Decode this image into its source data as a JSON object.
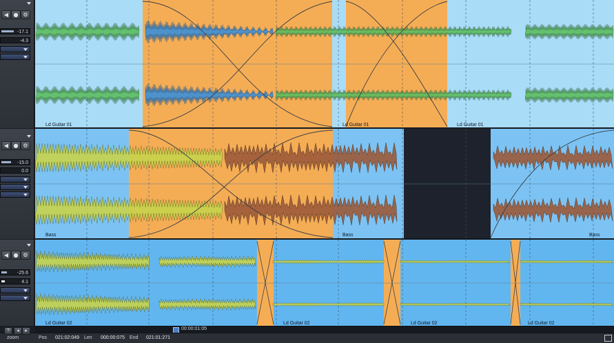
{
  "tracks": [
    {
      "id": "track1",
      "header": {
        "value1": "-17.1",
        "value2": "-4.3"
      },
      "clips": [
        {
          "label": "Ld Guitar 01"
        },
        {
          "label": "Ld Guitar 01"
        },
        {
          "label": "Ld Guitar 01"
        }
      ]
    },
    {
      "id": "track2",
      "header": {
        "value1": "-15.0",
        "value2": "0.0"
      },
      "clips": [
        {
          "label": "Bass"
        },
        {
          "label": "Bass"
        },
        {
          "label": "Bass"
        }
      ]
    },
    {
      "id": "track3",
      "header": {
        "value1": "-25.6",
        "value2": "4.1"
      },
      "clips": [
        {
          "label": "Ld Guitar 02"
        },
        {
          "label": "Ld Guitar 02"
        },
        {
          "label": "Ld Guitar 02"
        },
        {
          "label": "Ld Guitar 02"
        }
      ]
    }
  ],
  "ruler": {
    "position": "00:00:01:05"
  },
  "statusbar": {
    "zoom_label": "zoom",
    "pos_label": "Pos",
    "pos_value": "021:02:049",
    "len_label": "Len",
    "len_value": "000:00:075",
    "end_label": "End",
    "end_value": "021:01:271",
    "help_icon": "?"
  },
  "colors": {
    "lane_light": "#a9dcf7",
    "lane_mid": "#7cc3f4",
    "lane_deep": "#62b6f0",
    "crossfade": "#f5ad55",
    "empty_region": "#1d222c",
    "waveform_green": "#5bbd5f",
    "waveform_blue": "#3c8fd8",
    "waveform_yellow": "#c8d34b",
    "waveform_brown": "#9c5a3a"
  }
}
